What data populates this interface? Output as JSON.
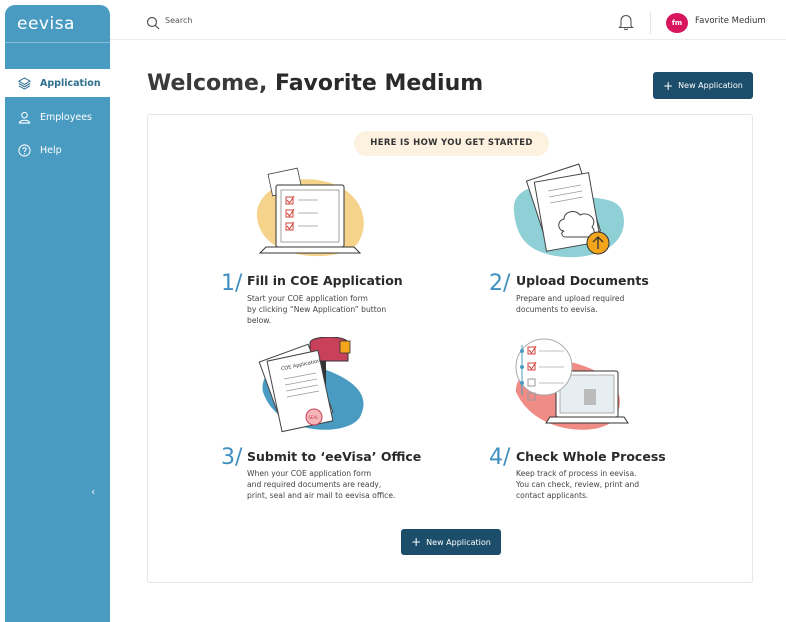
{
  "sidebar": {
    "brand": "eevisa",
    "items": [
      {
        "label": "Application",
        "icon": "layers-icon",
        "active": true
      },
      {
        "label": "Employees",
        "icon": "users-icon",
        "active": false
      },
      {
        "label": "Help",
        "icon": "help-icon",
        "active": false
      }
    ],
    "collapse_glyph": "‹"
  },
  "topbar": {
    "search_label": "Search",
    "user": {
      "avatar_text": "fm",
      "name": "Favorite Medium"
    }
  },
  "main": {
    "welcome_prefix": "Welcome, ",
    "welcome_name": "Favorite Medium",
    "new_application_label": "New Application",
    "get_started_label": "HERE IS HOW YOU GET STARTED",
    "steps": [
      {
        "number": "1/",
        "title": "Fill in COE Application",
        "desc": [
          "Start your COE application form",
          "by clicking “New Application” button",
          "below."
        ]
      },
      {
        "number": "2/",
        "title": "Upload Documents",
        "desc": [
          "Prepare and upload required",
          "documents to eevisa."
        ]
      },
      {
        "number": "3/",
        "title": "Submit to ‘eeVisa’ Office",
        "desc": [
          "When your COE application form",
          "and required documents are ready,",
          "print, seal and air mail to eevisa office."
        ]
      },
      {
        "number": "4/",
        "title": "Check Whole Process",
        "desc": [
          "Keep track of process in eevisa.",
          "You can check, review, print and",
          "contact applicants."
        ]
      }
    ],
    "illustration_text": {
      "coe_doc": "COE Application",
      "seal": "SEAL"
    }
  },
  "colors": {
    "sidebar": "#4a9bc1",
    "primary_button": "#1c4e6b",
    "accent_number": "#3f8fc0",
    "avatar": "#d8165d",
    "pill_bg": "#fdf1e0"
  }
}
